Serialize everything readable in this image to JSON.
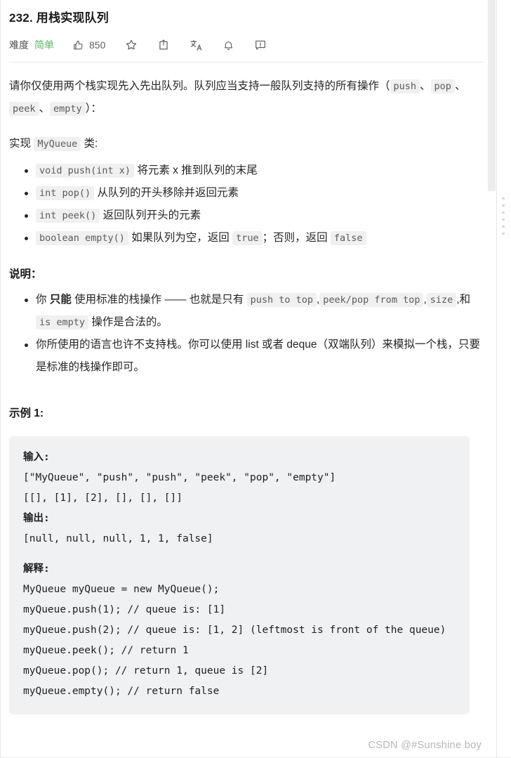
{
  "problem": {
    "title": "232. 用栈实现队列",
    "toolbar": {
      "difficulty_label": "难度",
      "difficulty_value": "简单",
      "likes_count": "850",
      "icons": [
        "thumbs-up-icon",
        "star-icon",
        "share-icon",
        "translate-icon",
        "bell-icon",
        "feedback-icon"
      ],
      "difficulty_color": "#5cb85c"
    },
    "intro": {
      "line1_a": "请你仅使用两个栈实现先入先出队列。队列应当支持一般队列支持的所有操作（",
      "code1": "push",
      "sep1": "、",
      "code2": "pop",
      "sep2": "、",
      "code3": "peek",
      "sep3": "、",
      "code4": "empty",
      "line1_b": "）："
    },
    "implement": {
      "prefix": "实现",
      "code": "MyQueue",
      "suffix": "类:"
    },
    "methods": [
      {
        "code": "void push(int x)",
        "text": "将元素 x 推到队列的末尾"
      },
      {
        "code": "int pop()",
        "text": "从队列的开头移除并返回元素"
      },
      {
        "code": "int peek()",
        "text": "返回队列开头的元素"
      },
      {
        "code": "boolean empty()",
        "text_a": "如果队列为空，返回",
        "code_true": "true",
        "text_b": "；否则，返回",
        "code_false": "false"
      }
    ],
    "notes": {
      "heading": "说明：",
      "item1": {
        "a": "你 ",
        "strong": "只能",
        "b": " 使用标准的栈操作 —— 也就是只有 ",
        "code1": "push to top",
        "c": ",",
        "code2": "peek/pop from top",
        "d": ",",
        "code3": "size",
        "e": ",和 ",
        "code4": "is empty",
        "f": " 操作是合法的。"
      },
      "item2": "你所使用的语言也许不支持栈。你可以使用 list 或者 deque（双端队列）来模拟一个栈，只要是标准的栈操作即可。"
    },
    "example": {
      "heading": "示例 1:",
      "input_label": "输入:",
      "input_line1": "[\"MyQueue\", \"push\", \"push\", \"peek\", \"pop\", \"empty\"]",
      "input_line2": "[[], [1], [2], [], [], []]",
      "output_label": "输出:",
      "output_line": "[null, null, null, 1, 1, false]",
      "explain_label": "解释:",
      "explain_lines": [
        "MyQueue myQueue = new MyQueue();",
        "myQueue.push(1); // queue is: [1]",
        "myQueue.push(2); // queue is: [1, 2] (leftmost is front of the queue)",
        "myQueue.peek(); // return 1",
        "myQueue.pop(); // return 1, queue is [2]",
        "myQueue.empty(); // return false"
      ]
    }
  },
  "watermark": "CSDN @#Sunshine boy"
}
